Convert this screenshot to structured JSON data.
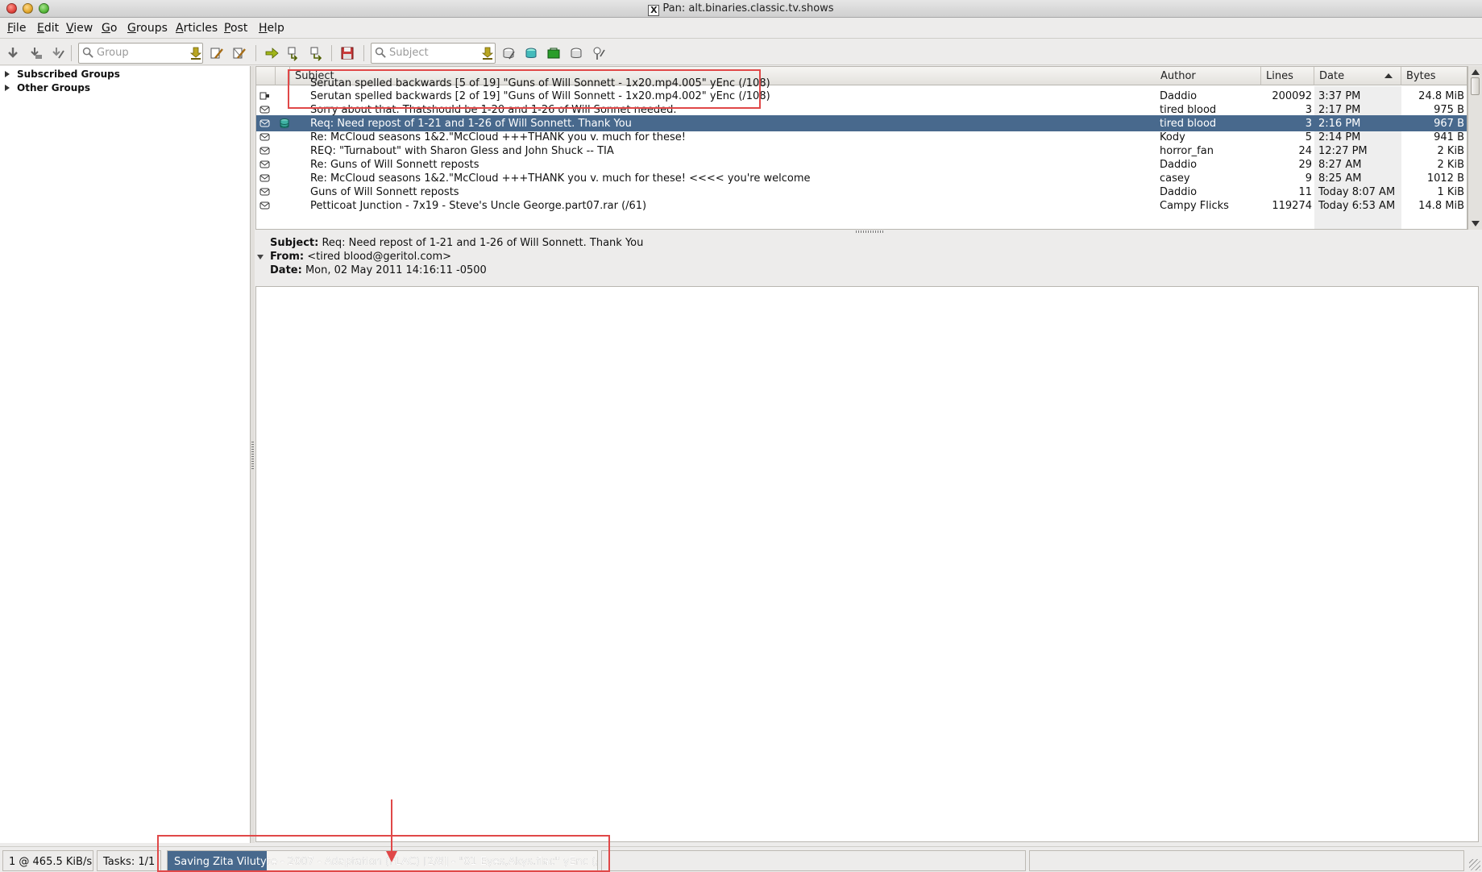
{
  "window": {
    "title": "Pan: alt.binaries.classic.tv.shows",
    "x_badge": "X"
  },
  "menubar": {
    "items": [
      {
        "label": "File",
        "accel": "F",
        "rest": "ile"
      },
      {
        "label": "Edit",
        "accel": "E",
        "rest": "dit"
      },
      {
        "label": "View",
        "accel": "V",
        "rest": "iew"
      },
      {
        "label": "Go",
        "accel": "G",
        "rest": "o"
      },
      {
        "label": "Groups",
        "accel": "G",
        "rest": "roups"
      },
      {
        "label": "Articles",
        "accel": "A",
        "rest": "rticles"
      },
      {
        "label": "Post",
        "accel": "P",
        "rest": "ost"
      },
      {
        "label": "Help",
        "accel": "H",
        "rest": "elp"
      }
    ]
  },
  "toolbar": {
    "group_search_placeholder": "Group",
    "subject_search_placeholder": "Subject"
  },
  "sidebar": {
    "items": [
      {
        "label": "Subscribed Groups"
      },
      {
        "label": "Other Groups"
      }
    ]
  },
  "headers": {
    "columns": {
      "subject": "Subject",
      "author": "Author",
      "lines": "Lines",
      "date": "Date",
      "bytes": "Bytes"
    },
    "rows": [
      {
        "subject": "Serutan spelled backwards [5 of 19] \"Guns of Will Sonnett - 1x20.mp4.005\" yEnc (/108)",
        "author": "",
        "lines": "",
        "date": "",
        "bytes": ""
      },
      {
        "subject": "Serutan spelled backwards [2 of 19] \"Guns of Will Sonnett - 1x20.mp4.002\" yEnc (/108)",
        "author": "Daddio",
        "lines": "200092",
        "date": "3:37 PM",
        "bytes": "24.8 MiB"
      },
      {
        "subject": "Sorry about that. Thatshould be 1-20 and 1-26 of Will Sonnet needed.",
        "author": "tired blood",
        "lines": "3",
        "date": "2:17 PM",
        "bytes": "975 B"
      },
      {
        "subject": "Req: Need repost of 1-21 and 1-26 of Will Sonnett. Thank You",
        "author": "tired blood",
        "lines": "3",
        "date": "2:16 PM",
        "bytes": "967 B"
      },
      {
        "subject": "Re: McCloud seasons 1&2.\"McCloud +++THANK you v. much for these!",
        "author": "Kody",
        "lines": "5",
        "date": "2:14 PM",
        "bytes": "941 B"
      },
      {
        "subject": "REQ: \"Turnabout\" with Sharon Gless and John Shuck -- TIA",
        "author": "horror_fan",
        "lines": "24",
        "date": "12:27 PM",
        "bytes": "2 KiB"
      },
      {
        "subject": "Re: Guns of Will Sonnett reposts",
        "author": "Daddio",
        "lines": "29",
        "date": "8:27 AM",
        "bytes": "2 KiB"
      },
      {
        "subject": "Re: McCloud seasons 1&2.\"McCloud +++THANK you v. much for these! <<<< you're welcome",
        "author": "casey",
        "lines": "9",
        "date": "8:25 AM",
        "bytes": "1012 B"
      },
      {
        "subject": "Guns of Will Sonnett reposts",
        "author": "Daddio",
        "lines": "11",
        "date": "Today  8:07 AM",
        "bytes": "1 KiB"
      },
      {
        "subject": "Petticoat Junction - 7x19 - Steve's Uncle George.part07.rar (/61)",
        "author": "Campy Flicks",
        "lines": "119274",
        "date": "Today  6:53 AM",
        "bytes": "14.8 MiB"
      }
    ],
    "selected_index": 3
  },
  "article": {
    "subject_label": "Subject:",
    "subject": "Req: Need repost of 1-21 and 1-26 of Will Sonnett. Thank You",
    "from_label": "From:",
    "from": "<tired blood@geritol.com>",
    "date_label": "Date:",
    "date": "Mon, 02 May 2011 14:16:11 -0500"
  },
  "statusbar": {
    "connection": "1 @ 465.5 KiB/s",
    "tasks": "Tasks: 1/1",
    "progress_text": "Saving Zita Vilutyte - 2007 - Adaptation (FLAC) [2/8] - \"01 Eyes,Akys.flac\" yEnc (/96)",
    "progress_fraction": 0.23
  },
  "colors": {
    "selection": "#48698d",
    "annotation": "#e04848"
  }
}
